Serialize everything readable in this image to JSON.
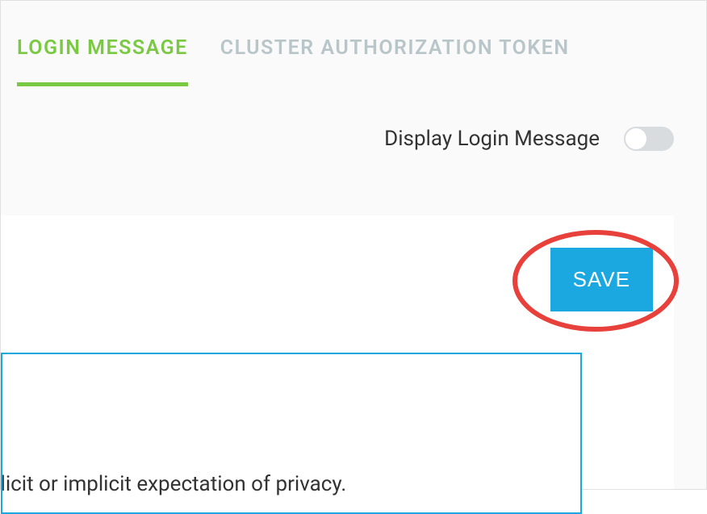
{
  "tabs": {
    "login_message": "LOGIN MESSAGE",
    "cluster_auth_token": "CLUSTER AUTHORIZATION TOKEN"
  },
  "toggle": {
    "label": "Display Login Message",
    "state": "off"
  },
  "actions": {
    "save": "SAVE"
  },
  "message_text": "xplicit or implicit expectation of privacy.",
  "annotation": {
    "ellipse_color": "#e8403a"
  }
}
